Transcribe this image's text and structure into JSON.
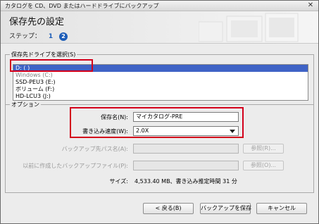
{
  "window": {
    "title": "カタログを CD、DVD またはハードドライブにバックアップ",
    "close_glyph": "✕"
  },
  "header": {
    "heading": "保存先の設定",
    "steps_label": "ステップ：",
    "step1": "1",
    "step2": "2"
  },
  "drive_group": {
    "legend": "保存先ドライブを選択(S)",
    "items": [
      "D: ( )",
      "Windows (C:)",
      "SSD-PEU3 (E:)",
      "ボリューム (F:)",
      "HD-LCU3 (J:)"
    ]
  },
  "options": {
    "legend": "オプション",
    "save_name_label": "保存名(N):",
    "save_name_value": "マイカタログ-PRE",
    "write_speed_label": "書き込み速度(W):",
    "write_speed_value": "2.0X",
    "backup_path_label": "バックアップ先パス名(A):",
    "backup_path_value": "",
    "prev_backup_label": "以前に作成したバックアップファイル(P):",
    "prev_backup_value": "",
    "browse1_label": "参照(R)...",
    "browse2_label": "参照(O)...",
    "size_label": "サイズ:",
    "size_value": "4,533.40 MB、書き込み推定時間 31 分"
  },
  "footer": {
    "back_label": "< 戻る(B)",
    "backup_label": "バックアップを保存",
    "cancel_label": "キャンセル"
  },
  "colors": {
    "highlight": "#d3001b",
    "selection": "#3f63c6",
    "accent": "#1d5db8"
  }
}
